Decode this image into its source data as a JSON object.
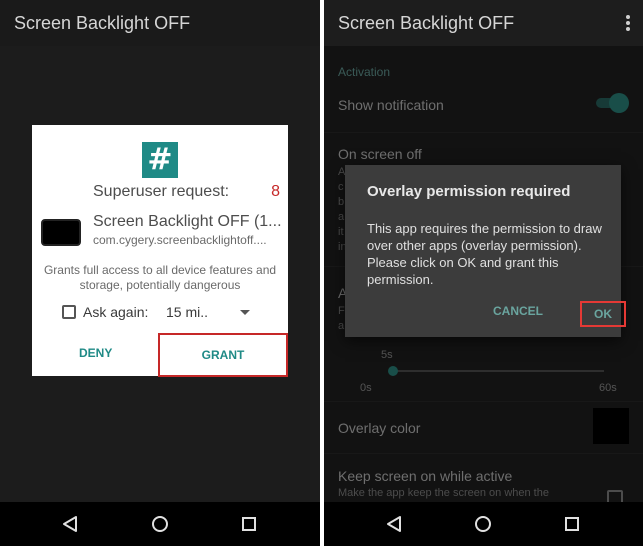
{
  "left": {
    "appbar_title": "Screen Backlight OFF",
    "dialog": {
      "icon_glyph": "#",
      "request_label": "Superuser request:",
      "countdown": "8",
      "app_name": "Screen Backlight OFF (1...",
      "package": "com.cygery.screenbacklightoff....",
      "description": "Grants full access to all device features and storage, potentially dangerous",
      "ask_again_label": "Ask again:",
      "timeout_value": "15 mi..",
      "deny_label": "DENY",
      "grant_label": "GRANT"
    }
  },
  "right": {
    "appbar_title": "Screen Backlight OFF",
    "section_activation": "Activation",
    "show_notification": "Show notification",
    "on_screen_off": "On screen off",
    "on_screen_off_sub_lines": [
      "A",
      "c",
      "b",
      "a",
      "it",
      "in"
    ],
    "hidden_title_fragment": "A",
    "hidden_sub_lines": [
      "F",
      "a"
    ],
    "seekbar_current": "5s",
    "seekbar_min": "0s",
    "seekbar_max": "60s",
    "overlay_color": "Overlay color",
    "keep_screen": "Keep screen on while active",
    "keep_screen_sub": "Make the app keep the screen on when the",
    "dialog": {
      "title": "Overlay permission required",
      "message": "This app requires the permission to draw over other apps (overlay permission). Please click on OK and grant this permission.",
      "cancel_label": "CANCEL",
      "ok_label": "OK"
    }
  },
  "colors": {
    "accent": "#1f8a86",
    "highlight": "#c62828"
  },
  "icons": {
    "superuser": "superuser-hash-icon",
    "back": "back-icon",
    "home": "home-icon",
    "recents": "recents-icon",
    "overflow": "overflow-menu-icon"
  }
}
